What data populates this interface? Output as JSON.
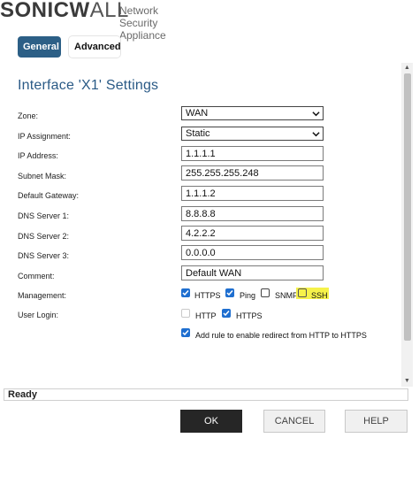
{
  "header": {
    "logo_bold": "SONICW",
    "logo_rest": "ALL",
    "subtitle": "Network Security Appliance"
  },
  "tabs": [
    {
      "label": "General",
      "active": true
    },
    {
      "label": "Advanced",
      "active": false
    }
  ],
  "form": {
    "title": "Interface 'X1' Settings",
    "zone": {
      "label": "Zone:",
      "value": "WAN"
    },
    "ip_assignment": {
      "label": "IP Assignment:",
      "value": "Static"
    },
    "ip_address": {
      "label": "IP Address:",
      "value": "1.1.1.1"
    },
    "subnet_mask": {
      "label": "Subnet Mask:",
      "value": "255.255.255.248"
    },
    "default_gateway": {
      "label": "Default Gateway:",
      "value": "1.1.1.2"
    },
    "dns1": {
      "label": "DNS Server 1:",
      "value": "8.8.8.8"
    },
    "dns2": {
      "label": "DNS Server 2:",
      "value": "4.2.2.2"
    },
    "dns3": {
      "label": "DNS Server 3:",
      "value": "0.0.0.0"
    },
    "comment": {
      "label": "Comment:",
      "value": "Default WAN"
    },
    "management": {
      "label": "Management:",
      "options": [
        {
          "label": "HTTPS",
          "checked": true
        },
        {
          "label": "Ping",
          "checked": true
        },
        {
          "label": "SNMP",
          "checked": false
        },
        {
          "label": "SSH",
          "checked": false,
          "highlight_color": "#f6f24a"
        }
      ]
    },
    "user_login": {
      "label": "User Login:",
      "options": [
        {
          "label": "HTTP",
          "checked": false,
          "disabled": true
        },
        {
          "label": "HTTPS",
          "checked": true
        }
      ]
    },
    "redirect_rule": {
      "label": "Add rule to enable redirect from HTTP to HTTPS",
      "checked": true
    }
  },
  "status": {
    "text": "Ready"
  },
  "buttons": {
    "ok": "OK",
    "cancel": "CANCEL",
    "help": "HELP"
  },
  "colors": {
    "accent": "#2c5f86",
    "title": "#2a5a86",
    "checkbox": "#1f6fd0",
    "ok_button": "#262626"
  }
}
